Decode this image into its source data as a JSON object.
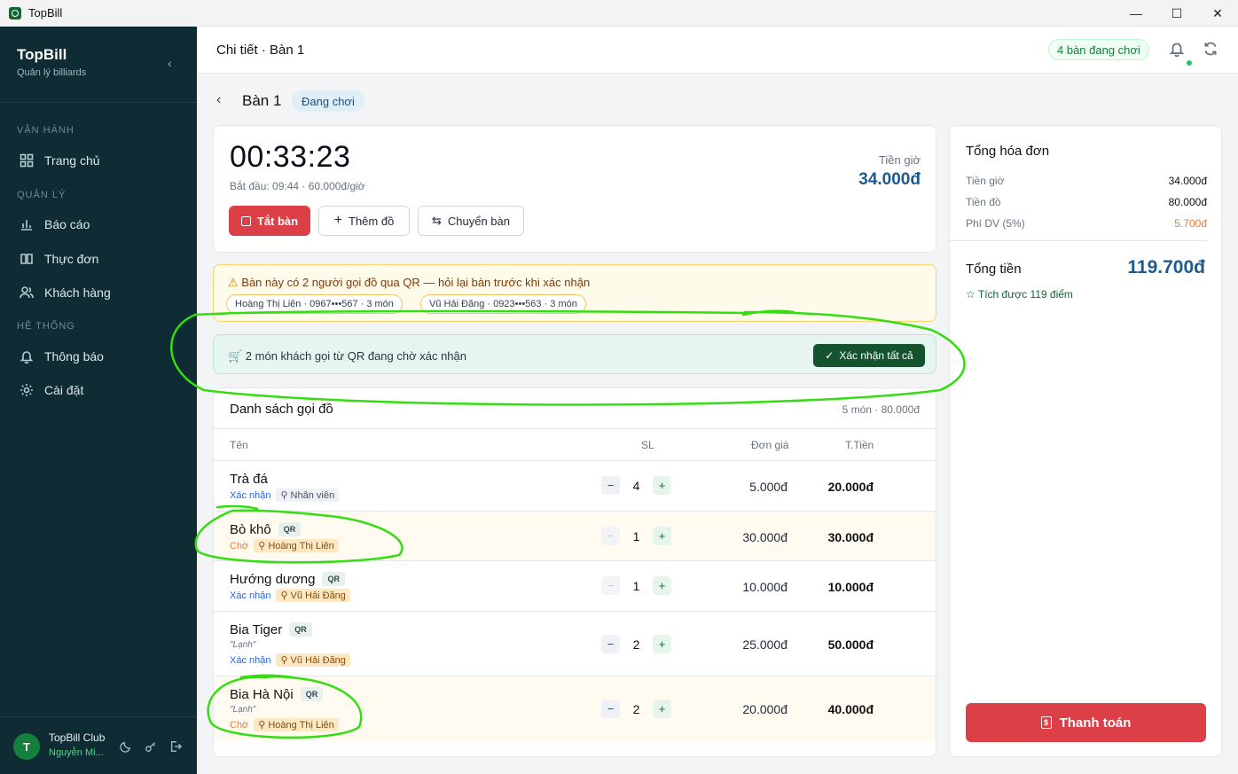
{
  "window": {
    "title": "TopBill",
    "minimize": "—",
    "maximize": "☐",
    "close": "✕"
  },
  "sidebar": {
    "brand": "TopBill",
    "subtitle": "Quản lý billiards",
    "sections": {
      "ops": "VẬN HÀNH",
      "manage": "QUẢN LÝ",
      "system": "HỆ THỐNG"
    },
    "items": [
      {
        "label": "Trang chủ",
        "icon": "grid-icon"
      },
      {
        "label": "Báo cáo",
        "icon": "chart-icon"
      },
      {
        "label": "Thực đơn",
        "icon": "book-icon"
      },
      {
        "label": "Khách hàng",
        "icon": "users-icon"
      },
      {
        "label": "Thông báo",
        "icon": "bell-icon"
      },
      {
        "label": "Cài đặt",
        "icon": "gear-icon"
      }
    ],
    "footer": {
      "avatar": "T",
      "club": "TopBill Club",
      "user": "Nguyễn Mi..."
    }
  },
  "header": {
    "breadcrumb": "Chi tiết · Bàn 1",
    "active_tables": "4 bàn đang chơi"
  },
  "page": {
    "back": "‹",
    "title": "Bàn 1",
    "status": "Đang chơi"
  },
  "timer": {
    "elapsed": "00:33:23",
    "start_info": "Bắt đầu: 09:44 · 60.000đ/giờ",
    "time_fee_label": "Tiền giờ",
    "time_fee": "34.000đ",
    "buttons": {
      "close_table": "Tắt bàn",
      "add_item": "Thêm đồ",
      "move_table": "Chuyển bàn"
    }
  },
  "warning": {
    "text": "Bàn này có 2 người gọi đồ qua QR — hỏi lại bàn trước khi xác nhận",
    "chips": [
      "Hoàng Thị Liên · 0967•••567 · 3 món",
      "Vũ Hải Đăng · 0923•••563 · 3 món"
    ]
  },
  "qr_notice": {
    "text": "🛒 2 món khách gọi từ QR đang chờ xác nhận",
    "button": "Xác nhận tất cả"
  },
  "order_list": {
    "title": "Danh sách gọi đồ",
    "meta": "5 món · 80.000đ",
    "columns": {
      "name": "Tên",
      "qty": "SL",
      "price": "Đơn giá",
      "total": "T.Tiền"
    },
    "rows": [
      {
        "name": "Trà đá",
        "qr": "",
        "note": "",
        "status": "Xác nhận",
        "by": "Nhân viên",
        "qty": "4",
        "price": "5.000đ",
        "total": "20.000đ"
      },
      {
        "name": "Bò khô",
        "qr": "QR",
        "note": "",
        "status": "Chờ",
        "by": "Hoàng Thị Liên",
        "qty": "1",
        "price": "30.000đ",
        "total": "30.000đ"
      },
      {
        "name": "Hướng dương",
        "qr": "QR",
        "note": "",
        "status": "Xác nhận",
        "by": "Vũ Hải Đăng",
        "qty": "1",
        "price": "10.000đ",
        "total": "10.000đ"
      },
      {
        "name": "Bia Tiger",
        "qr": "QR",
        "note": "\"Lạnh\"",
        "status": "Xác nhận",
        "by": "Vũ Hải Đăng",
        "qty": "2",
        "price": "25.000đ",
        "total": "50.000đ"
      },
      {
        "name": "Bia Hà Nội",
        "qr": "QR",
        "note": "\"Lạnh\"",
        "status": "Chờ",
        "by": "Hoàng Thị Liên",
        "qty": "2",
        "price": "20.000đ",
        "total": "40.000đ"
      }
    ],
    "minus": "−",
    "plus": "+"
  },
  "summary": {
    "title": "Tổng hóa đơn",
    "lines": [
      {
        "label": "Tiền giờ",
        "value": "34.000đ"
      },
      {
        "label": "Tiền đồ",
        "value": "80.000đ"
      },
      {
        "label": "Phí DV (5%)",
        "value": "5.700đ"
      }
    ],
    "grand_label": "Tổng tiền",
    "grand_value": "119.700đ",
    "points": "☆ Tích được 119 điểm",
    "pay_button": "Thanh toán"
  },
  "colors": {
    "sidebar": "#0f2b33",
    "accent_blue": "#1d5a8f",
    "danger": "#dc3f46",
    "confirm": "#14532d",
    "annotation": "#33dd11"
  }
}
